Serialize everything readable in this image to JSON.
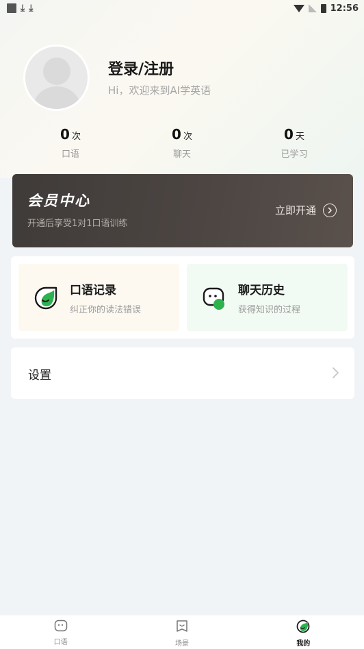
{
  "status_bar": {
    "time": "12:56"
  },
  "profile": {
    "title": "登录/注册",
    "subtitle": "Hi，欢迎来到AI学英语"
  },
  "stats": [
    {
      "value": "0",
      "unit": "次",
      "label": "口语"
    },
    {
      "value": "0",
      "unit": "次",
      "label": "聊天"
    },
    {
      "value": "0",
      "unit": "天",
      "label": "已学习"
    }
  ],
  "vip": {
    "title": "会员中心",
    "subtitle": "开通后享受1对1口语训练",
    "action": "立即开通"
  },
  "features": {
    "speak": {
      "title": "口语记录",
      "subtitle": "纠正你的读法错误",
      "icon": "speech-bubble-icon"
    },
    "chat": {
      "title": "聊天历史",
      "subtitle": "获得知识的过程",
      "icon": "chat-face-icon"
    }
  },
  "settings": {
    "label": "设置"
  },
  "tab_bar": {
    "tabs": [
      {
        "label": "口语",
        "icon": "chat-face-icon"
      },
      {
        "label": "场景",
        "icon": "scene-icon"
      },
      {
        "label": "我的",
        "icon": "profile-leaf-icon"
      }
    ],
    "active_index": 2
  },
  "colors": {
    "accent_green": "#2db24f",
    "vip_bg": "#453f3c",
    "page_bg": "#f1f4f7"
  }
}
